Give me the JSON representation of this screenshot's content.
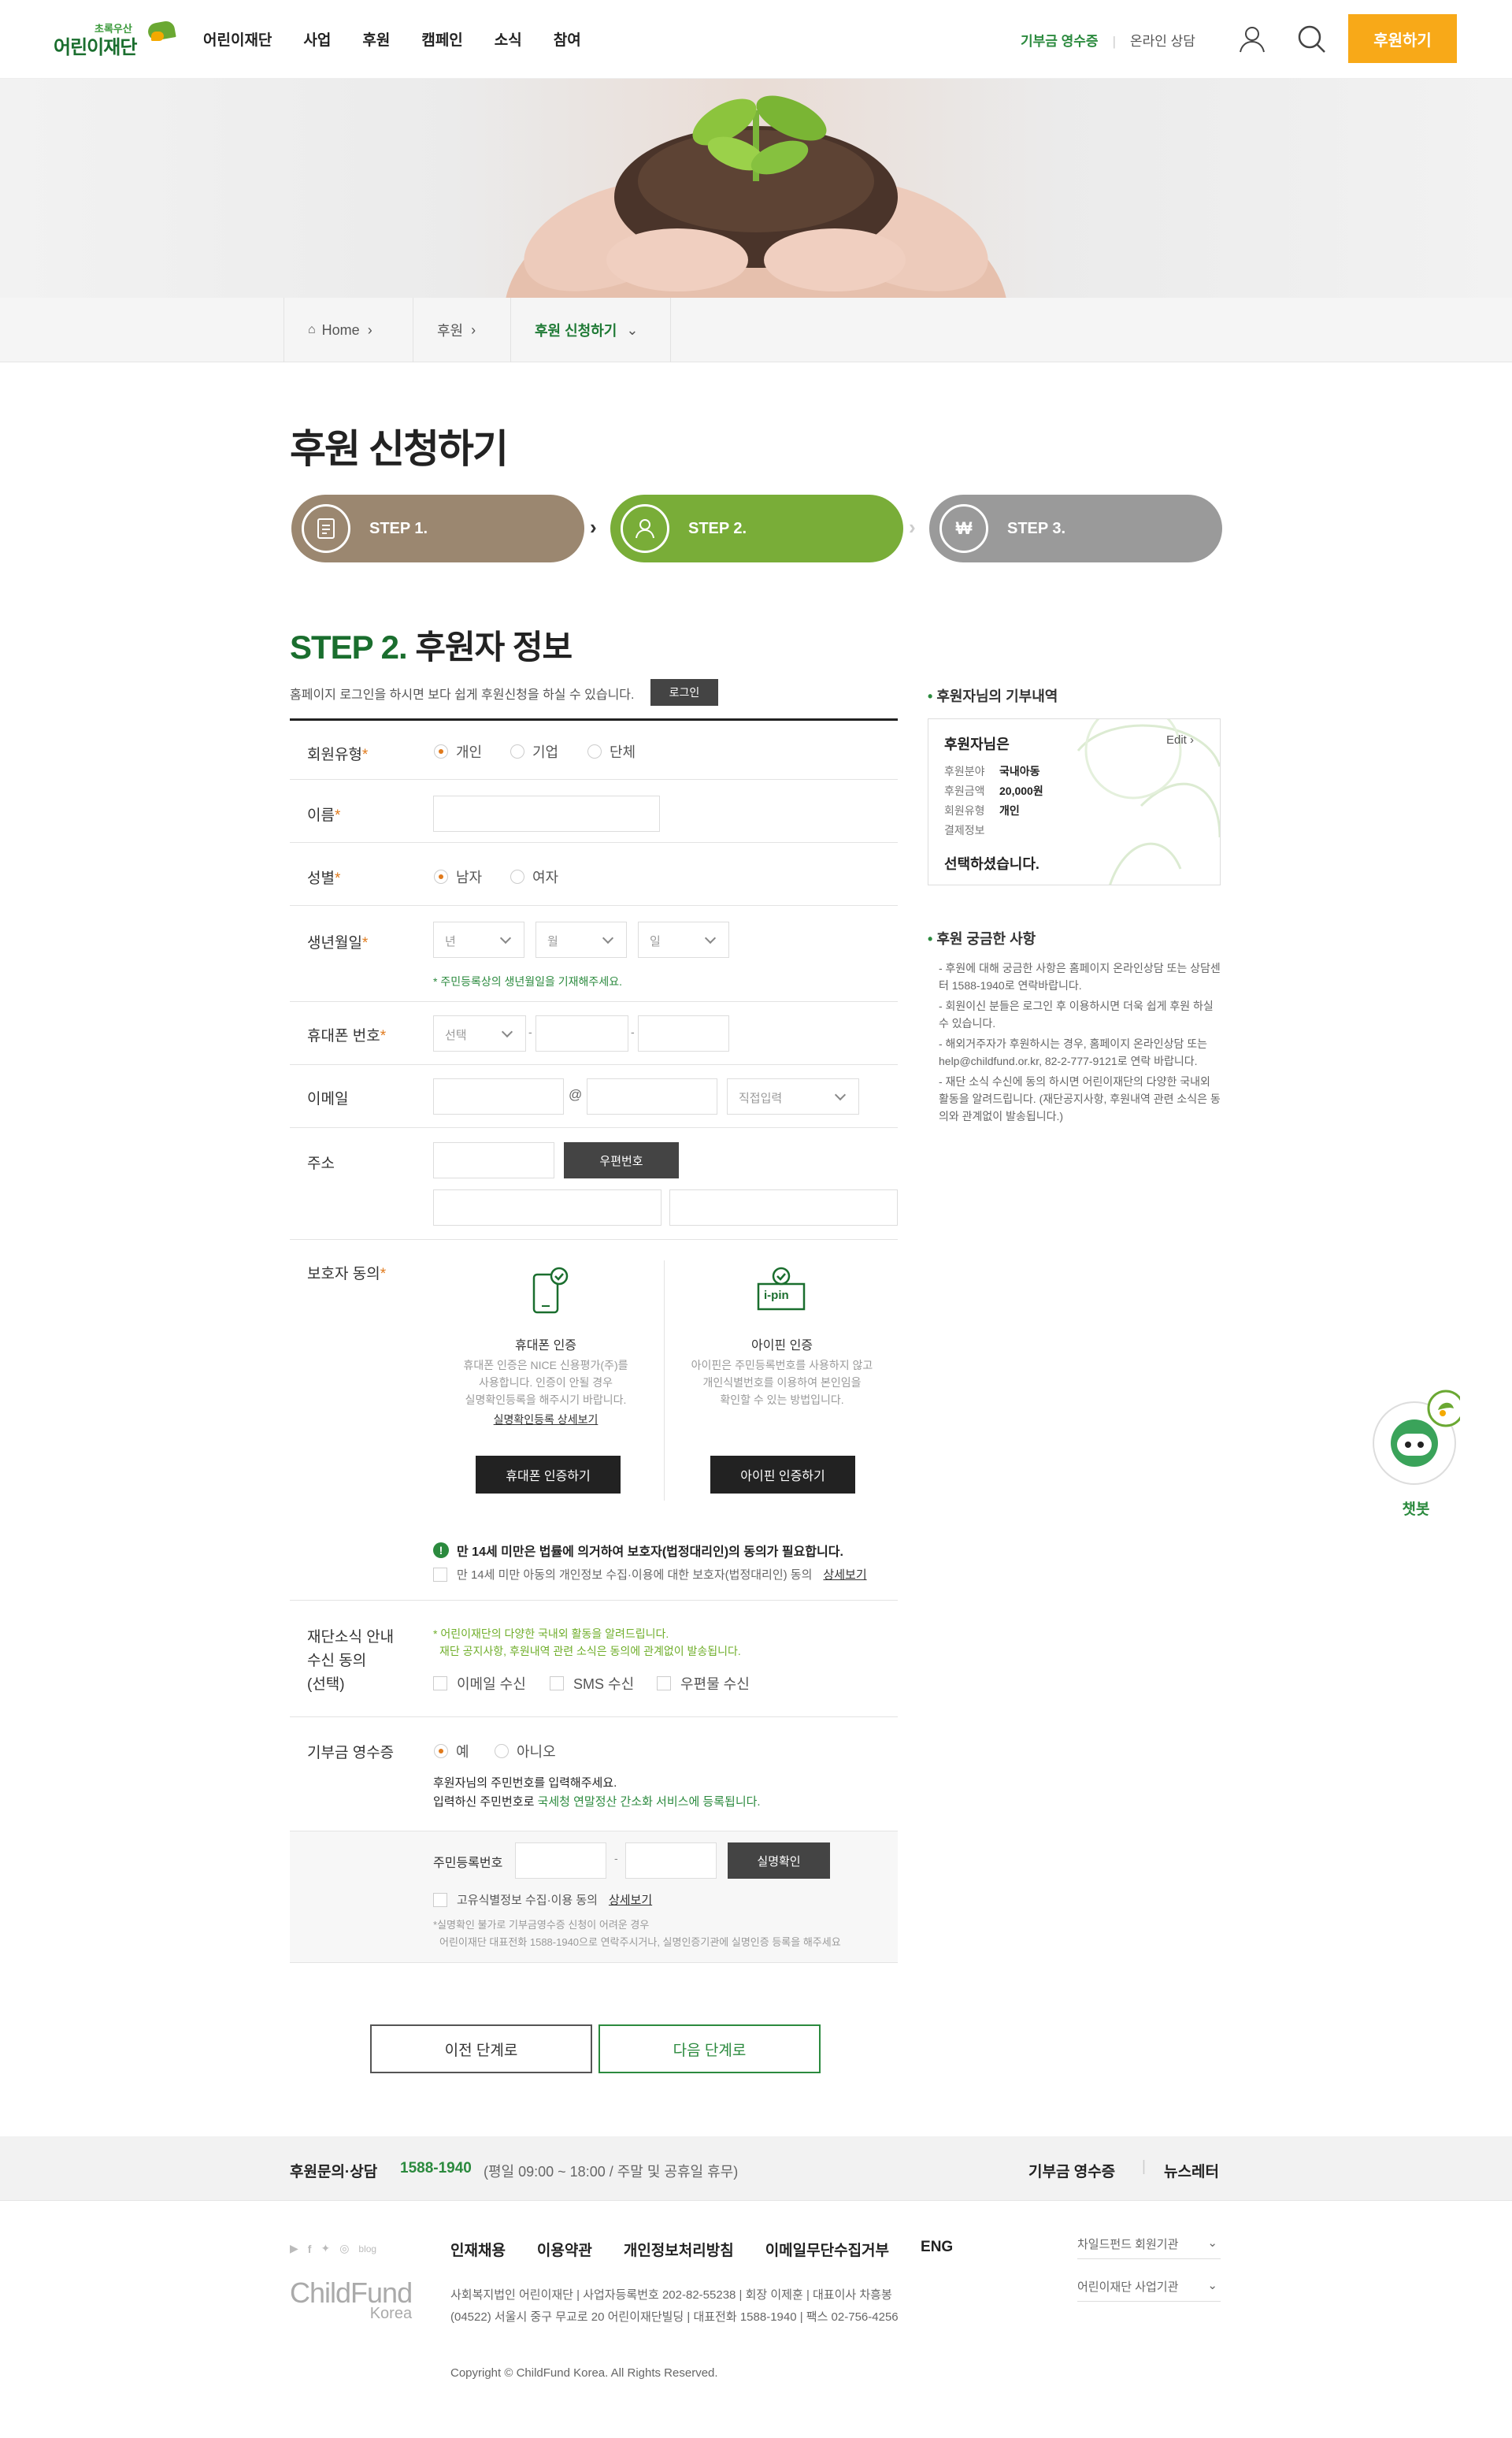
{
  "header": {
    "logo_small": "초록우산",
    "logo_big": "어린이재단",
    "nav": [
      "어린이재단",
      "사업",
      "후원",
      "캠페인",
      "소식",
      "참여"
    ],
    "receipt_link": "기부금 영수증",
    "online_consult": "온라인 상담",
    "donate_button": "후원하기"
  },
  "breadcrumb": {
    "home": "Home",
    "level1": "후원",
    "current": "후원 신청하기"
  },
  "page_title": "후원 신청하기",
  "steps": [
    {
      "label": "STEP 1.",
      "color": "#9b8770"
    },
    {
      "label": "STEP 2.",
      "color": "#79ad38"
    },
    {
      "label": "STEP 3.",
      "color": "#9a9a9a"
    }
  ],
  "section": {
    "step_prefix": "STEP 2.",
    "title": "후원자 정보",
    "login_note": "홈페이지 로그인을 하시면 보다 쉽게 후원신청을 하실 수 있습니다.",
    "login_button": "로그인"
  },
  "form": {
    "member_type": {
      "label": "회원유형",
      "options": [
        "개인",
        "기업",
        "단체"
      ],
      "selected": "개인"
    },
    "name": {
      "label": "이름"
    },
    "gender": {
      "label": "성별",
      "options": [
        "남자",
        "여자"
      ],
      "selected": "남자"
    },
    "birth": {
      "label": "생년월일",
      "year": "년",
      "month": "월",
      "day": "일",
      "note": "* 주민등록상의 생년월일을 기재해주세요."
    },
    "phone": {
      "label": "휴대폰 번호",
      "select": "선택",
      "dash": "-"
    },
    "email": {
      "label": "이메일",
      "at": "@",
      "domain_select": "직접입력"
    },
    "address": {
      "label": "주소",
      "zip_button": "우편번호"
    },
    "guardian": {
      "label": "보호자 동의",
      "phone_title": "휴대폰 인증",
      "phone_desc": [
        "휴대폰 인증은 NICE 신용평가(주)를",
        "사용합니다. 인증이 안될 경우",
        "실명확인등록을 해주시기 바랍니다."
      ],
      "phone_link": "실명확인등록 상세보기",
      "phone_button": "휴대폰 인증하기",
      "ipin_title": "아이핀 인증",
      "ipin_badge": "i-pin",
      "ipin_desc": [
        "아이핀은 주민등록번호를 사용하지 않고",
        "개인식별번호를 이용하여 본인임을",
        "확인할 수 있는 방법입니다."
      ],
      "ipin_button": "아이핀 인증하기",
      "warning": "만 14세 미만은 법률에 의거하여 보호자(법정대리인)의 동의가 필요합니다.",
      "agree_text": "만 14세 미만 아동의 개인정보 수집·이용에 대한 보호자(법정대리인) 동의",
      "agree_link": "상세보기"
    },
    "newsletter": {
      "label_lines": [
        "재단소식 안내",
        "수신 동의",
        "(선택)"
      ],
      "note1": "* 어린이재단의 다양한 국내외 활동을 알려드립니다.",
      "note2": "재단 공지사항, 후원내역 관련 소식은 동의에 관계없이 발송됩니다.",
      "options": [
        "이메일 수신",
        "SMS 수신",
        "우편물 수신"
      ]
    },
    "receipt": {
      "label": "기부금 영수증",
      "options": [
        "예",
        "아니오"
      ],
      "selected": "예",
      "desc1": "후원자님의 주민번호를 입력해주세요.",
      "desc2_a": "입력하신 주민번호로 ",
      "desc2_b": "국세청 연말정산 간소화 서비스에 등록됩니다.",
      "rrn_label": "주민등록번호",
      "verify_button": "실명확인",
      "consent": "고유식별정보 수집·이용 동의",
      "consent_link": "상세보기",
      "small1": "*실명확인 불가로 기부금영수증 신청이 어려운 경우",
      "small2": "어린이재단 대표전화 1588-1940으로 연락주시거나, 실명인증기관에 실명인증 등록을 해주세요"
    }
  },
  "sidebar": {
    "summary_title": "후원자님의 기부내역",
    "donor": "후원자님은",
    "edit": "Edit",
    "rows": [
      {
        "k": "후원분야",
        "v": "국내아동"
      },
      {
        "k": "후원금액",
        "v": "20,000원"
      },
      {
        "k": "회원유형",
        "v": "개인"
      },
      {
        "k": "결제정보",
        "v": ""
      }
    ],
    "selected_text": "선택하셨습니다.",
    "faq_title": "후원 궁금한 사항",
    "faq": [
      "- 후원에 대해 궁금한 사항은 홈페이지 온라인상담 또는 상담센터 1588-1940로 연락바랍니다.",
      "- 회원이신 분들은 로그인 후 이용하시면 더욱 쉽게 후원 하실 수 있습니다.",
      "- 해외거주자가 후원하시는 경우, 홈페이지 온라인상담 또는 help@childfund.or.kr, 82-2-777-9121로 연락 바랍니다.",
      "- 재단 소식 수신에 동의 하시면 어린이재단의 다양한 국내외 활동을 알려드립니다. (재단공지사항, 후원내역 관련 소식은 동의와 관계없이 발송됩니다.)"
    ]
  },
  "buttons": {
    "prev": "이전 단계로",
    "next": "다음 단계로"
  },
  "chatbot": {
    "label": "챗봇"
  },
  "footer": {
    "consult_label": "후원문의·상담",
    "phone": "1588-1940",
    "hours": "(평일 09:00 ~ 18:00 / 주말 및 공휴일 휴무)",
    "receipt": "기부금 영수증",
    "newsletter": "뉴스레터",
    "links": [
      "인재채용",
      "이용약관",
      "개인정보처리방침",
      "이메일무단수집거부",
      "ENG"
    ],
    "social": [
      "youtube",
      "facebook",
      "twitter",
      "instagram",
      "blog"
    ],
    "blog_label": "blog",
    "brand": "ChildFund",
    "brand_sub": "Korea",
    "info1": "사회복지법인 어린이재단 | 사업자등록번호 202-82-55238 | 회장 이제훈 | 대표이사 차흥봉",
    "info2": "(04522) 서울시 중구 무교로 20 어린이재단빌딩 | 대표전화 1588-1940 | 팩스 02-756-4256",
    "copyright": "Copyright © ChildFund Korea. All Rights Reserved.",
    "family1": "차일드펀드 회원기관",
    "family2": "어린이재단 사업기관"
  }
}
